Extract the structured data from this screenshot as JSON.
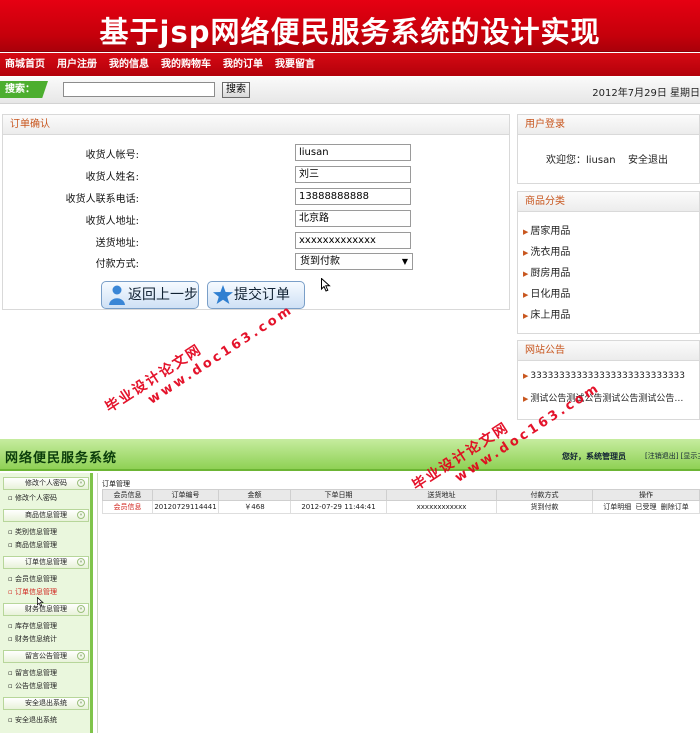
{
  "site": {
    "banner_title": "基于jsp网络便民服务系统的设计实现",
    "nav": [
      "商城首页",
      "用户注册",
      "我的信息",
      "我的购物车",
      "我的订单",
      "我要留言"
    ],
    "search": {
      "tag": "搜索：",
      "button": "搜索",
      "value": ""
    },
    "date_text": "2012年7月29日  星期日"
  },
  "order": {
    "header": "订单确认",
    "fields": [
      {
        "label": "收货人帐号:",
        "value": "liusan"
      },
      {
        "label": "收货人姓名:",
        "value": "刘三"
      },
      {
        "label": "收货人联系电话:",
        "value": "13888888888"
      },
      {
        "label": "收货人地址:",
        "value": "北京路"
      },
      {
        "label": "送货地址:",
        "value": "xxxxxxxxxxxxx"
      }
    ],
    "payment_label": "付款方式:",
    "payment_value": "货到付款",
    "back_button": "返回上一步",
    "submit_button": "提交订单"
  },
  "login": {
    "header": "用户登录",
    "welcome": "欢迎您：liusan",
    "logout": "安全退出"
  },
  "categories": {
    "header": "商品分类",
    "items": [
      "居家用品",
      "洗衣用品",
      "厨房用品",
      "日化用品",
      "床上用品"
    ]
  },
  "notice": {
    "header": "网站公告",
    "items": [
      "333333333333333333333333333",
      "测试公告测试公告测试公告测试公告…"
    ]
  },
  "watermark": {
    "line1": "毕业设计论文网",
    "line2": "www.doc163.com"
  },
  "admin": {
    "title": "网络便民服务系统",
    "hello": "您好，系统管理员",
    "links": "[注销退出] [显示主",
    "breadcrumb": "订单管理",
    "sections": [
      {
        "title": "修改个人密码",
        "items": [
          "修改个人密码"
        ]
      },
      {
        "title": "商品信息管理",
        "items": [
          "类别信息管理",
          "商品信息管理"
        ]
      },
      {
        "title": "订单信息管理",
        "items": [
          "会员信息管理",
          "订单信息管理"
        ]
      },
      {
        "title": "财务信息管理",
        "items": [
          "库存信息管理",
          "财务信息统计"
        ]
      },
      {
        "title": "留言公告管理",
        "items": [
          "留言信息管理",
          "公告信息管理"
        ]
      },
      {
        "title": "安全退出系统",
        "items": [
          "安全退出系统"
        ]
      }
    ],
    "table": {
      "headers": [
        "会员信息",
        "订单编号",
        "金额",
        "下单日期",
        "送货地址",
        "付款方式",
        "操作"
      ],
      "rows": [
        {
          "member": "会员信息",
          "order_no": "20120729114441",
          "amount": "￥468",
          "date": "2012-07-29 11:44:41",
          "address": "xxxxxxxxxxxx",
          "payment": "货到付款",
          "ops": [
            "订单明细",
            "已受理",
            "删除订单"
          ]
        }
      ]
    }
  },
  "colors": {
    "brand_red": "#c5000b",
    "admin_green": "#8fd155",
    "accent_orange": "#c8561e"
  }
}
